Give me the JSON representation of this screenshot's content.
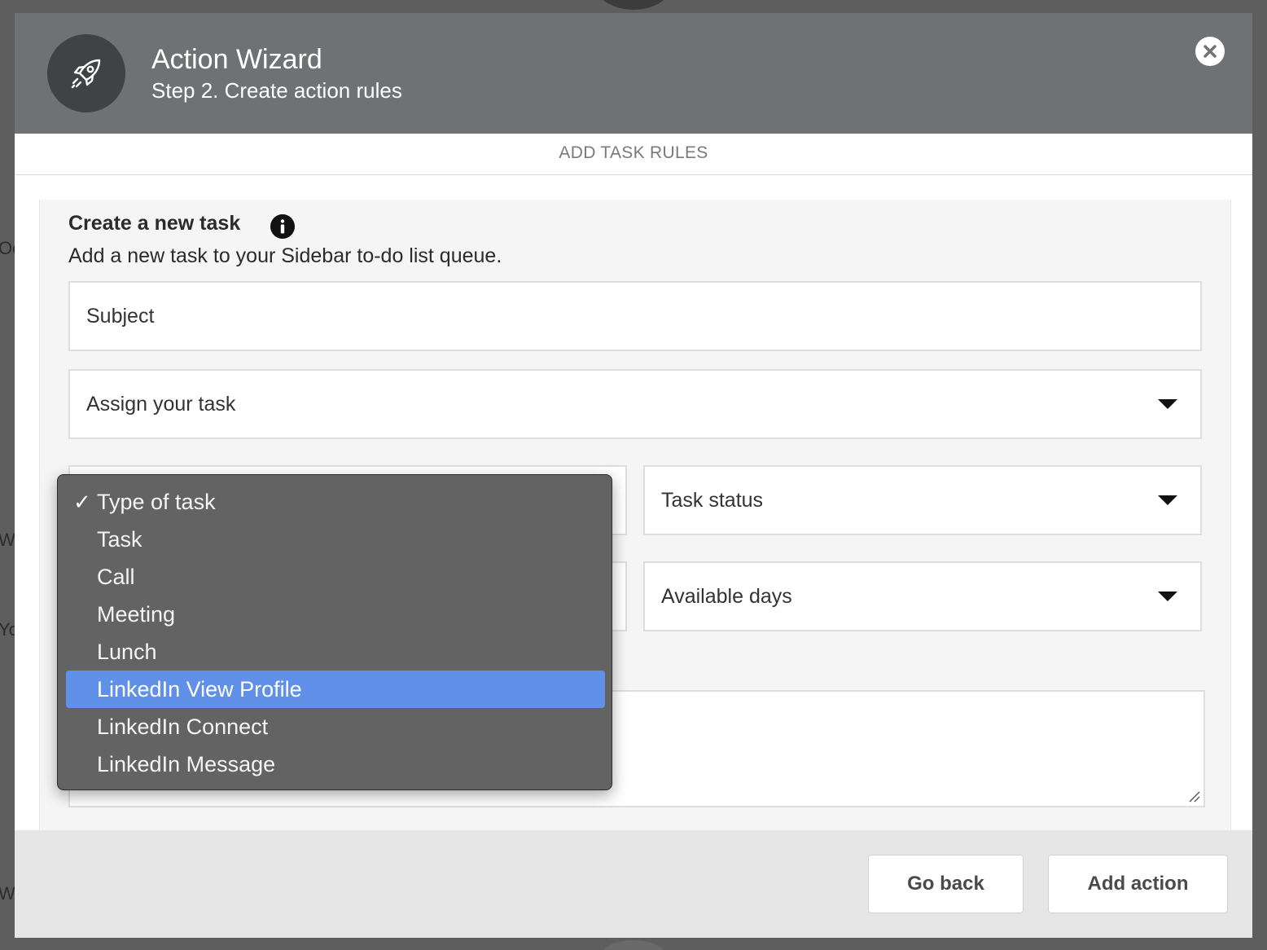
{
  "modal": {
    "title": "Action Wizard",
    "subtitle": "Step 2. Create action rules",
    "section_title": "ADD TASK RULES"
  },
  "panel": {
    "title": "Create a new task",
    "description": "Add a new task to your Sidebar to-do list queue."
  },
  "fields": {
    "subject_placeholder": "Subject",
    "assign_task": "Assign your task",
    "task_status": "Task status",
    "available_days": "Available days"
  },
  "task_type_menu": {
    "selected_index": 0,
    "highlighted_index": 5,
    "check_mark": "✓",
    "options": [
      "Type of task",
      "Task",
      "Call",
      "Meeting",
      "Lunch",
      "LinkedIn View Profile",
      "LinkedIn Connect",
      "LinkedIn Message"
    ]
  },
  "footer": {
    "go_back": "Go back",
    "add_action": "Add action"
  },
  "background_fragments": [
    "Oc",
    "W",
    "Yo",
    "W"
  ],
  "colors": {
    "header_bg": "#6f7175",
    "menu_bg": "#636363",
    "menu_highlight": "#6190e8",
    "footer_bg": "#e6e6e6"
  },
  "icons": {
    "header": "rocket-icon",
    "close": "close-icon",
    "info": "info-icon",
    "dropdown": "chevron-down-icon",
    "selected": "checkmark-icon"
  }
}
